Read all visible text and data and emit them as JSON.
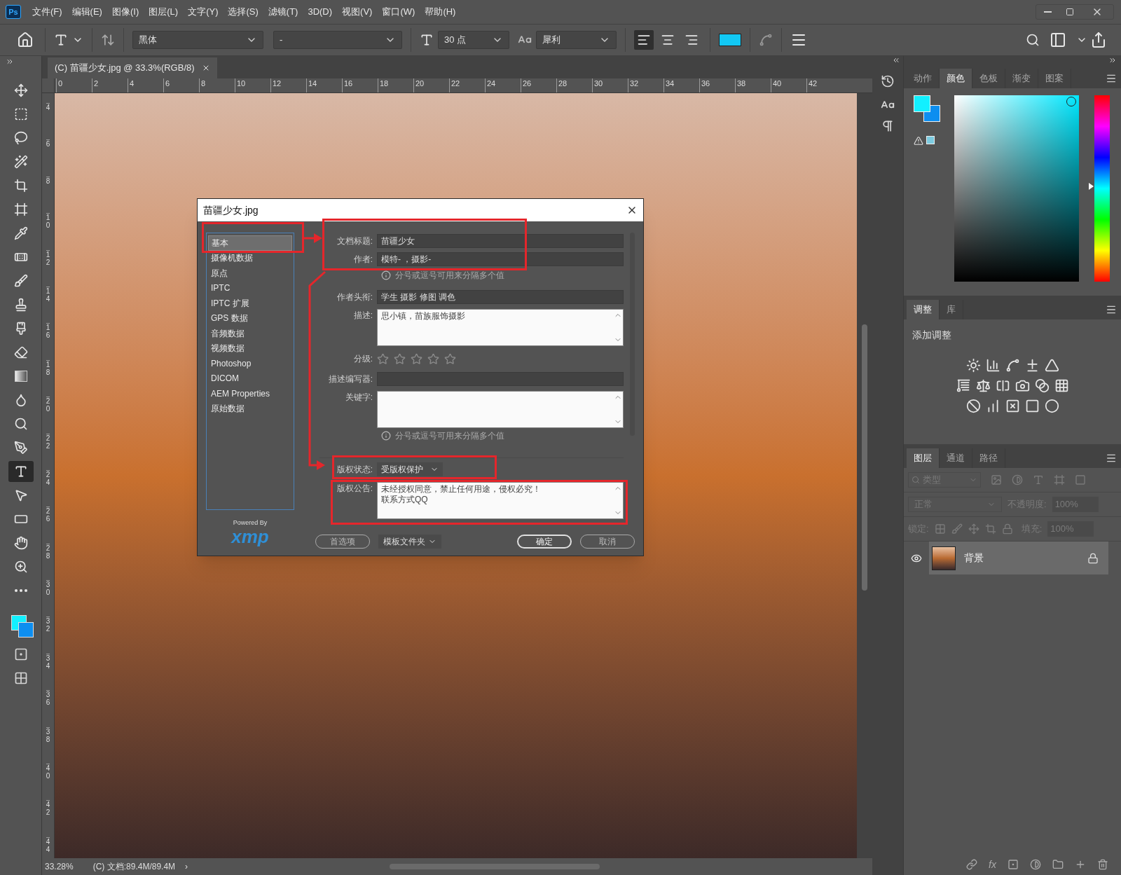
{
  "menu": {
    "app_badge": "Ps",
    "items": [
      "文件(F)",
      "编辑(E)",
      "图像(I)",
      "图层(L)",
      "文字(Y)",
      "选择(S)",
      "滤镜(T)",
      "3D(D)",
      "视图(V)",
      "窗口(W)",
      "帮助(H)"
    ]
  },
  "options_bar": {
    "font_family": "黑体",
    "font_style": "-",
    "font_size": "30 点",
    "antialias": "犀利",
    "align": [
      {
        "kind": "left",
        "selected": true
      },
      {
        "kind": "center",
        "selected": false
      },
      {
        "kind": "right",
        "selected": false
      }
    ]
  },
  "document_tab": {
    "title": "(C) 苗疆少女.jpg @ 33.3%(RGB/8)"
  },
  "rulers": {
    "horizontal": [
      "0",
      "2",
      "4",
      "6",
      "8",
      "10",
      "12",
      "14",
      "16",
      "18",
      "20",
      "22",
      "24",
      "26",
      "28",
      "30",
      "32",
      "34",
      "36",
      "38",
      "40",
      "42"
    ],
    "vertical": [
      "4",
      "6",
      "8",
      "10",
      "12",
      "14",
      "16",
      "18",
      "20",
      "22",
      "24",
      "26",
      "28",
      "30",
      "32",
      "34",
      "36",
      "38",
      "40",
      "42",
      "44"
    ]
  },
  "tools": [
    {
      "kind": "move",
      "selected": false
    },
    {
      "kind": "marquee",
      "selected": false
    },
    {
      "kind": "lasso",
      "selected": false
    },
    {
      "kind": "quick_select",
      "selected": false
    },
    {
      "kind": "crop",
      "selected": false
    },
    {
      "kind": "frame",
      "selected": false
    },
    {
      "kind": "eyedropper",
      "selected": false
    },
    {
      "kind": "healing",
      "selected": false
    },
    {
      "kind": "brush",
      "selected": false
    },
    {
      "kind": "stamp",
      "selected": false
    },
    {
      "kind": "history_brush",
      "selected": false
    },
    {
      "kind": "eraser",
      "selected": false
    },
    {
      "kind": "gradient",
      "selected": false
    },
    {
      "kind": "blur",
      "selected": false
    },
    {
      "kind": "dodge",
      "selected": false
    },
    {
      "kind": "pen",
      "selected": false
    },
    {
      "kind": "type",
      "selected": true
    },
    {
      "kind": "path_select",
      "selected": false
    },
    {
      "kind": "shape",
      "selected": false
    },
    {
      "kind": "hand",
      "selected": false
    },
    {
      "kind": "zoom",
      "selected": false
    },
    {
      "kind": "more",
      "selected": false
    }
  ],
  "dialog": {
    "title": "苗疆少女.jpg",
    "categories": [
      {
        "label": "基本",
        "selected": true
      },
      {
        "label": "摄像机数据",
        "selected": false
      },
      {
        "label": "原点",
        "selected": false
      },
      {
        "label": "IPTC",
        "selected": false
      },
      {
        "label": "IPTC 扩展",
        "selected": false
      },
      {
        "label": "GPS 数据",
        "selected": false
      },
      {
        "label": "音频数据",
        "selected": false
      },
      {
        "label": "视频数据",
        "selected": false
      },
      {
        "label": "Photoshop",
        "selected": false
      },
      {
        "label": "DICOM",
        "selected": false
      },
      {
        "label": "AEM Properties",
        "selected": false
      },
      {
        "label": "原始数据",
        "selected": false
      }
    ],
    "powered_by": "Powered By",
    "logo": "xmp",
    "fields": [
      {
        "kind": "input",
        "label": "文档标题:",
        "value": "苗疆少女"
      },
      {
        "kind": "input",
        "label": "作者:",
        "value": "模特-    ，摄影-"
      },
      {
        "kind": "hint",
        "text": "分号或逗号可用来分隔多个值"
      },
      {
        "kind": "input",
        "label": "作者头衔:",
        "value": "学生 摄影 修图 调色"
      },
      {
        "kind": "textarea",
        "label": "描述:",
        "lines": [
          "思小镇，苗族服饰摄影"
        ]
      },
      {
        "kind": "stars",
        "label": "分级:",
        "stars": 0
      },
      {
        "kind": "input",
        "label": "描述编写器:"
      },
      {
        "kind": "textarea",
        "label": "关键字:"
      },
      {
        "kind": "hint",
        "text": "分号或逗号可用来分隔多个值"
      },
      {
        "kind": "select",
        "label": "版权状态:",
        "value": "受版权保护"
      },
      {
        "kind": "textarea",
        "label": "版权公告:",
        "lines": [
          "未经授权同意，禁止任何用途，侵权必究！",
          "联系方式QQ"
        ]
      }
    ],
    "buttons": [
      {
        "kind": "outline",
        "label": "首选项"
      },
      {
        "kind": "dropdown",
        "label": "模板文件夹"
      },
      {
        "kind": "primary",
        "label": "确定"
      },
      {
        "kind": "outline",
        "label": "取消"
      }
    ]
  },
  "status_bar": {
    "zoom": "33.28%",
    "info": "(C) 文档:89.4M/89.4M",
    "arrow": "›"
  },
  "color_panel": {
    "hue": {
      "level": 0.49
    },
    "tabs": [
      {
        "label": "动作",
        "selected": false
      },
      {
        "label": "颜色",
        "selected": true
      },
      {
        "label": "色板",
        "selected": false
      },
      {
        "label": "渐变",
        "selected": false
      },
      {
        "label": "图案",
        "selected": false
      }
    ]
  },
  "adjustments_panel": {
    "tabs": [
      {
        "label": "调整",
        "selected": true
      },
      {
        "label": "库",
        "selected": false
      }
    ],
    "heading": "添加调整"
  },
  "layers_panel": {
    "tabs": [
      {
        "label": "图层",
        "selected": true
      },
      {
        "label": "通道",
        "selected": false
      },
      {
        "label": "路径",
        "selected": false
      }
    ],
    "filter": "类型",
    "blend_mode": "正常",
    "opacity_label": "不透明度:",
    "opacity": "100%",
    "lock_label": "锁定:",
    "fill_label": "填充:",
    "fill": "100%",
    "layers": [
      {
        "name": "背景",
        "visible": true,
        "locked": true,
        "selected": true
      }
    ],
    "footer_fx": "fx"
  }
}
